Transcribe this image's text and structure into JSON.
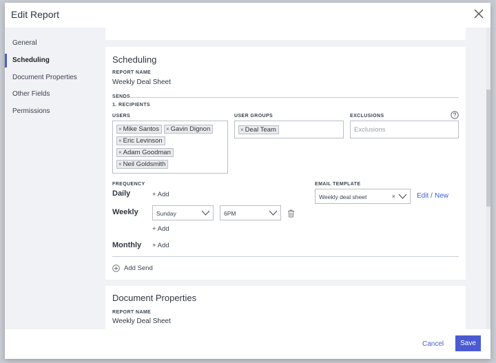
{
  "dialog": {
    "title": "Edit Report",
    "cancel_label": "Cancel",
    "save_label": "Save",
    "accent_color": "#4a5bd2"
  },
  "sidebar": {
    "items": [
      {
        "label": "General"
      },
      {
        "label": "Scheduling",
        "active": true
      },
      {
        "label": "Document Properties"
      },
      {
        "label": "Other Fields"
      },
      {
        "label": "Permissions"
      }
    ]
  },
  "scheduling": {
    "title": "Scheduling",
    "report_name_label": "REPORT NAME",
    "report_name": "Weekly Deal Sheet",
    "sends_label": "SENDS",
    "recipients_label": "1. RECIPIENTS",
    "users_label": "USERS",
    "users": [
      "Mike Santos",
      "Gavin Dignon",
      "Eric Levinson",
      "Adam Goodman",
      "Neil Goldsmith"
    ],
    "user_groups_label": "USER GROUPS",
    "user_groups": [
      "Deal Team"
    ],
    "exclusions_label": "EXCLUSIONS",
    "exclusions_placeholder": "Exclusions",
    "help_icon": "help-circle-icon",
    "frequency_label": "FREQUENCY",
    "daily_label": "Daily",
    "weekly_label": "Weekly",
    "monthly_label": "Monthly",
    "add_label": "+ Add",
    "weekly_day": "Sunday",
    "weekly_time": "6PM",
    "email_template_label": "EMAIL TEMPLATE",
    "email_template": "Weekly deal sheet",
    "edit_label": "Edit",
    "slash": "/",
    "new_label": "New",
    "add_send_label": "Add Send"
  },
  "document_properties": {
    "title": "Document Properties",
    "report_name_label": "REPORT NAME",
    "report_name": "Weekly Deal Sheet"
  }
}
